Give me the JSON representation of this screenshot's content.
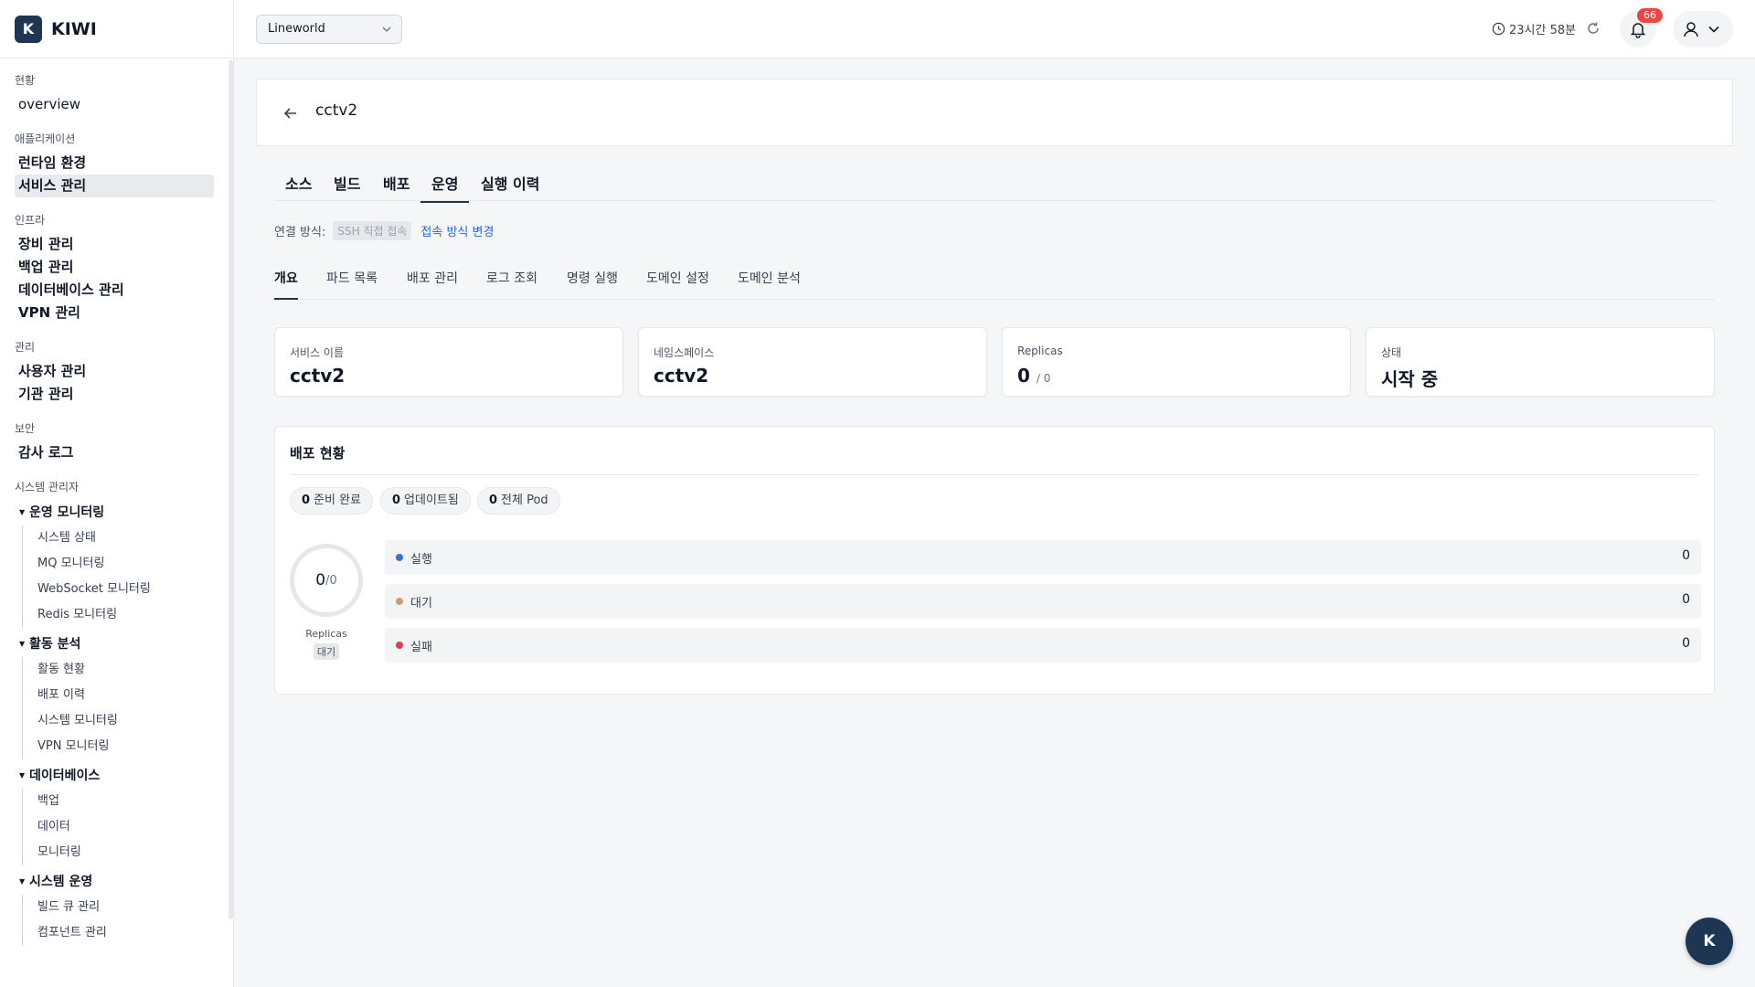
{
  "brand": {
    "logo_letter": "K",
    "name": "KIWI",
    "color": "#1e3553"
  },
  "sidebar": {
    "sections": [
      {
        "label": "현황",
        "items": [
          {
            "label": "overview"
          }
        ]
      },
      {
        "label": "애플리케이션",
        "items": [
          {
            "label": "런타임 환경"
          },
          {
            "label": "서비스 관리",
            "active": true
          }
        ]
      },
      {
        "label": "인프라",
        "items": [
          {
            "label": "장비 관리"
          },
          {
            "label": "백업 관리"
          },
          {
            "label": "데이터베이스 관리"
          },
          {
            "label": "VPN 관리"
          }
        ]
      },
      {
        "label": "관리",
        "items": [
          {
            "label": "사용자 관리"
          },
          {
            "label": "기관 관리"
          }
        ]
      },
      {
        "label": "보안",
        "items": [
          {
            "label": "감사 로그"
          }
        ]
      }
    ],
    "system_admin": {
      "label": "시스템 관리자",
      "groups": [
        {
          "label": "운영 모니터링",
          "items": [
            "시스템 상태",
            "MQ 모니터링",
            "WebSocket 모니터링",
            "Redis 모니터링"
          ]
        },
        {
          "label": "활동 분석",
          "items": [
            "활동 현황",
            "배포 이력",
            "시스템 모니터링",
            "VPN 모니터링"
          ]
        },
        {
          "label": "데이터베이스",
          "items": [
            "백업",
            "데이터",
            "모니터링"
          ]
        },
        {
          "label": "시스템 운영",
          "items": [
            "빌드 큐 관리",
            "컴포넌트 관리"
          ]
        }
      ]
    }
  },
  "topbar": {
    "project": "Lineworld",
    "session_time": "23시간 58분",
    "notification_count": "66"
  },
  "page": {
    "title": "cctv2",
    "main_tabs": [
      "소스",
      "빌드",
      "배포",
      "운영",
      "실행 이력"
    ],
    "active_main_tab": "운영",
    "connection": {
      "label": "연결 방식:",
      "value": "SSH 직접 접속",
      "change_link": "접속 방식 변경"
    },
    "sub_tabs": [
      "개요",
      "파드 목록",
      "배포 관리",
      "로그 조회",
      "명령 실행",
      "도메인 설정",
      "도메인 분석"
    ],
    "active_sub_tab": "개요",
    "stats": [
      {
        "label": "서비스 이름",
        "value": "cctv2"
      },
      {
        "label": "네임스페이스",
        "value": "cctv2"
      },
      {
        "label": "Replicas",
        "value": "0",
        "sub": "/ 0"
      },
      {
        "label": "상태",
        "value": "시작 중"
      }
    ],
    "deploy": {
      "title": "배포 현황",
      "chips": [
        {
          "num": "0",
          "label": "준비 완료"
        },
        {
          "num": "0",
          "label": "업데이트됨"
        },
        {
          "num": "0",
          "label": "전체 Pod"
        }
      ],
      "ring": {
        "value": "0",
        "total": "/0",
        "label": "Replicas",
        "tag": "대기"
      },
      "statuses": [
        {
          "label": "실행",
          "value": "0",
          "color": "#3b6fd8"
        },
        {
          "label": "대기",
          "value": "0",
          "color": "#c9a063"
        },
        {
          "label": "실패",
          "value": "0",
          "color": "#d9414f"
        }
      ]
    }
  },
  "fab": {
    "label": "K"
  }
}
